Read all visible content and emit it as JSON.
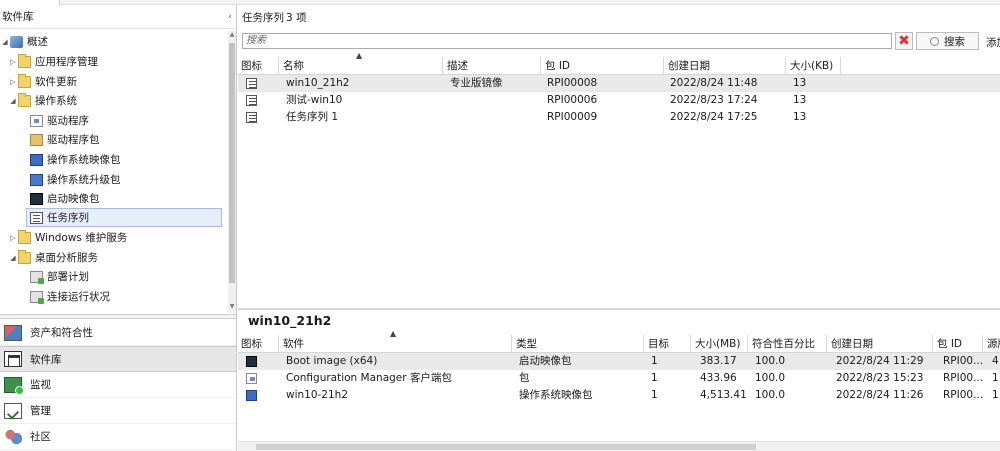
{
  "left": {
    "title": "软件库",
    "collapse": "‹",
    "tree": [
      {
        "label": "概述",
        "icon": "overview-icon",
        "level": 0,
        "expander": "◢"
      },
      {
        "label": "应用程序管理",
        "icon": "folder-icon",
        "level": 1,
        "expander": "▷"
      },
      {
        "label": "软件更新",
        "icon": "folder-icon",
        "level": 1,
        "expander": "▷"
      },
      {
        "label": "操作系统",
        "icon": "folder-icon",
        "level": 1,
        "expander": "◢"
      },
      {
        "label": "驱动程序",
        "icon": "driver-icon",
        "level": 2,
        "expander": ""
      },
      {
        "label": "驱动程序包",
        "icon": "driver-package-icon",
        "level": 2,
        "expander": ""
      },
      {
        "label": "操作系统映像包",
        "icon": "os-image-icon",
        "level": 2,
        "expander": ""
      },
      {
        "label": "操作系统升级包",
        "icon": "os-upgrade-icon",
        "level": 2,
        "expander": ""
      },
      {
        "label": "启动映像包",
        "icon": "boot-image-icon",
        "level": 2,
        "expander": ""
      },
      {
        "label": "任务序列",
        "icon": "task-sequence-icon",
        "level": 2,
        "expander": "",
        "selected": true
      },
      {
        "label": "Windows 维护服务",
        "icon": "folder-icon",
        "level": 1,
        "expander": "▷"
      },
      {
        "label": "桌面分析服务",
        "icon": "folder-icon",
        "level": 1,
        "expander": "◢"
      },
      {
        "label": "部署计划",
        "icon": "deployment-plan-icon",
        "level": 2,
        "expander": ""
      },
      {
        "label": "连接运行状况",
        "icon": "connection-health-icon",
        "level": 2,
        "expander": ""
      }
    ],
    "workspaces": [
      {
        "label": "资产和符合性",
        "icon": "assets-icon"
      },
      {
        "label": "软件库",
        "icon": "library-icon",
        "active": true
      },
      {
        "label": "监视",
        "icon": "monitoring-icon"
      },
      {
        "label": "管理",
        "icon": "administration-icon"
      },
      {
        "label": "社区",
        "icon": "community-icon"
      }
    ]
  },
  "main": {
    "title": "任务序列",
    "count": "3 项",
    "search_placeholder": "搜索",
    "clear_icon": "✖",
    "search_button": "搜索",
    "add_criteria": "添加",
    "columns": [
      "图标",
      "名称",
      "描述",
      "包 ID",
      "创建日期",
      "大小(KB)"
    ],
    "rows": [
      {
        "name": "win10_21h2",
        "description": "专业版镜像",
        "package_id": "RPI00008",
        "created": "2022/8/24 11:48",
        "size": "13"
      },
      {
        "name": "测试-win10",
        "description": "",
        "package_id": "RPI00006",
        "created": "2022/8/23 17:24",
        "size": "13"
      },
      {
        "name": "任务序列 1",
        "description": "",
        "package_id": "RPI00009",
        "created": "2022/8/24 17:25",
        "size": "13"
      }
    ]
  },
  "detail": {
    "title": "win10_21h2",
    "columns": [
      "图标",
      "软件",
      "类型",
      "目标",
      "大小(MB)",
      "符合性百分比",
      "创建日期",
      "包 ID",
      "源版"
    ],
    "rows": [
      {
        "icon": "boot-image-icon",
        "software": "Boot image (x64)",
        "type": "启动映像包",
        "target": "1",
        "size": "383.17",
        "compliance": "100.0",
        "created": "2022/8/24 11:29",
        "package_id": "RPI00...",
        "source": "4"
      },
      {
        "icon": "client-package-icon",
        "software": "Configuration Manager 客户端包",
        "type": "包",
        "target": "1",
        "size": "433.96",
        "compliance": "100.0",
        "created": "2022/8/23 15:23",
        "package_id": "RPI00...",
        "source": "1"
      },
      {
        "icon": "os-image-icon",
        "software": "win10-21h2",
        "type": "操作系统映像包",
        "target": "1",
        "size": "4,513.41",
        "compliance": "100.0",
        "created": "2022/8/24 11:26",
        "package_id": "RPI00...",
        "source": "1"
      }
    ]
  }
}
